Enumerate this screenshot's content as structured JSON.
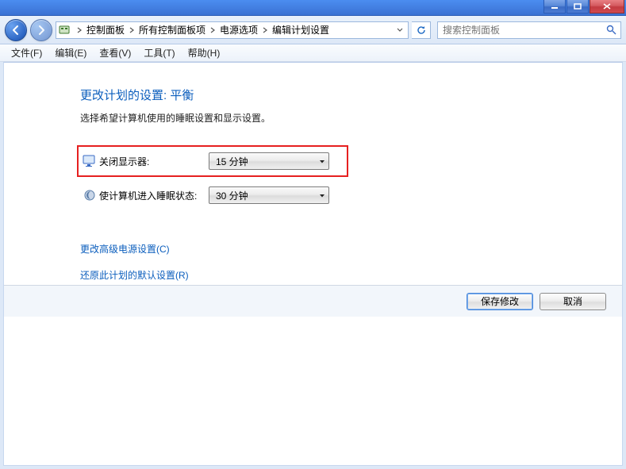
{
  "breadcrumb": {
    "items": [
      "控制面板",
      "所有控制面板项",
      "电源选项",
      "编辑计划设置"
    ]
  },
  "search": {
    "placeholder": "搜索控制面板"
  },
  "menu": {
    "file": "文件(F)",
    "edit": "编辑(E)",
    "view": "查看(V)",
    "tools": "工具(T)",
    "help": "帮助(H)"
  },
  "page": {
    "title": "更改计划的设置: 平衡",
    "subtitle": "选择希望计算机使用的睡眠设置和显示设置。"
  },
  "settings": {
    "display_off": {
      "label": "关闭显示器:",
      "value": "15 分钟"
    },
    "sleep": {
      "label": "使计算机进入睡眠状态:",
      "value": "30 分钟"
    }
  },
  "links": {
    "advanced": "更改高级电源设置(C)",
    "restore": "还原此计划的默认设置(R)"
  },
  "buttons": {
    "save": "保存修改",
    "cancel": "取消"
  }
}
